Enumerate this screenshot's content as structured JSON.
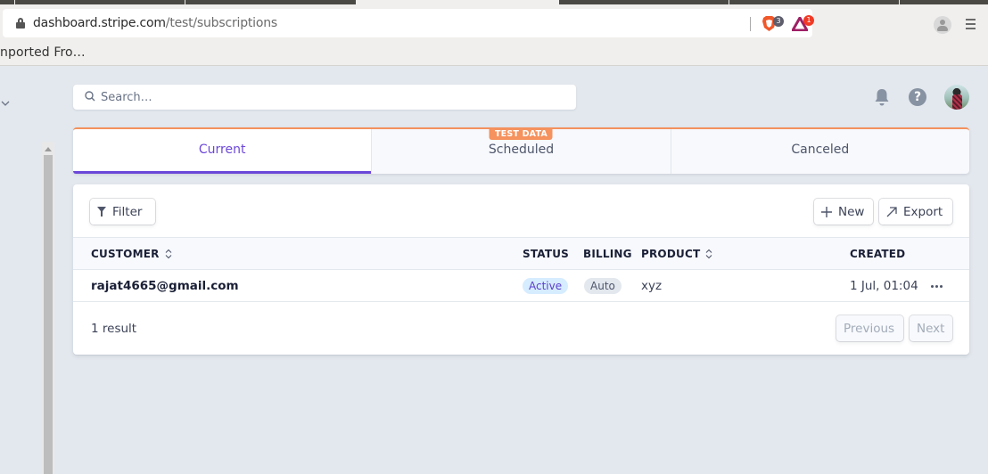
{
  "browser": {
    "url_host": "dashboard.stripe.com",
    "url_path": "/test/subscriptions",
    "bookmark": "nported Fro…",
    "brave_shields_count": "3",
    "rewards_count": "1"
  },
  "header": {
    "search_placeholder": "Search…"
  },
  "tabs": [
    {
      "label": "Current",
      "active": true
    },
    {
      "label": "Scheduled",
      "badge": "TEST DATA"
    },
    {
      "label": "Canceled"
    }
  ],
  "toolbar": {
    "filter_label": "Filter",
    "new_label": "New",
    "export_label": "Export"
  },
  "table": {
    "columns": [
      "CUSTOMER",
      "STATUS",
      "BILLING",
      "PRODUCT",
      "CREATED"
    ],
    "rows": [
      {
        "customer": "rajat4665@gmail.com",
        "status": "Active",
        "billing": "Auto",
        "product": "xyz",
        "created": "1 Jul, 01:04"
      }
    ]
  },
  "footer": {
    "result_count": "1 result",
    "previous_label": "Previous",
    "next_label": "Next"
  },
  "colors": {
    "accent": "#6c48d9",
    "test_data": "#f5925e",
    "page_bg": "#e3e8ee"
  }
}
